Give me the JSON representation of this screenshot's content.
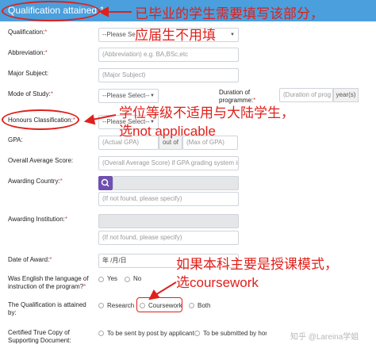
{
  "header": {
    "title": "Qualification attained 1"
  },
  "fields": {
    "qualification": {
      "label": "Qualification:",
      "req": "*",
      "placeholder": "--Please Se"
    },
    "abbreviation": {
      "label": "Abbreviation:",
      "req": "*",
      "placeholder": "(Abbreviation) e.g. BA,BSc,etc"
    },
    "major": {
      "label": "Major Subject:",
      "placeholder": "(Major Subject)"
    },
    "mode": {
      "label": "Mode of Study:",
      "req": "*",
      "placeholder": "--Please Select--"
    },
    "duration": {
      "label1": "Duration of",
      "label2": "programme:",
      "req": "*",
      "placeholder": "(Duration of prog",
      "unit": "year(s)"
    },
    "honours": {
      "label": "Honours Classification:",
      "req": "*",
      "placeholder": "--Please Select--"
    },
    "gpa": {
      "label": "GPA:",
      "actual": "(Actual GPA)",
      "outof": "out of",
      "max": "(Max of GPA)"
    },
    "overall": {
      "label": "Overall Average Score:",
      "placeholder": "(Overall Average Score) if GPA grading system is"
    },
    "country": {
      "label": "Awarding Country:",
      "req": "*",
      "hint": "(If not found, please specify)"
    },
    "institution": {
      "label": "Awarding Institution:",
      "req": "*",
      "hint": "(If not found, please specify)"
    },
    "date": {
      "label": "Date of Award:",
      "req": "*",
      "value": "年 /月/日"
    },
    "english": {
      "label1": "Was English the language of",
      "label2": "instruction of the program?",
      "req": "*",
      "options": [
        "Yes",
        "No"
      ]
    },
    "attained": {
      "label1": "The Qualification is attained",
      "label2": "by:",
      "options": [
        "Research",
        "Coursework",
        "Both"
      ]
    },
    "certified": {
      "label1": "Certified True Copy of",
      "label2": "Supporting Document:",
      "options": [
        "To be sent by post by applicant",
        "To be submitted by hon"
      ]
    }
  },
  "annotations": {
    "a1_line1": "已毕业的学生需要填写该部分，",
    "a1_line2": "应届生不用填",
    "a2_line1": "学位等级不适用与大陆学生，",
    "a2_line2": "选not applicable",
    "a3_line1": "如果本科主要是授课模式，",
    "a3_line2": "选coursework"
  },
  "watermark": {
    "text": "知乎 @Lareina学姐"
  },
  "colors": {
    "header": "#4a9fdc",
    "annotation": "#e0201b",
    "search": "#6f4fb0"
  }
}
